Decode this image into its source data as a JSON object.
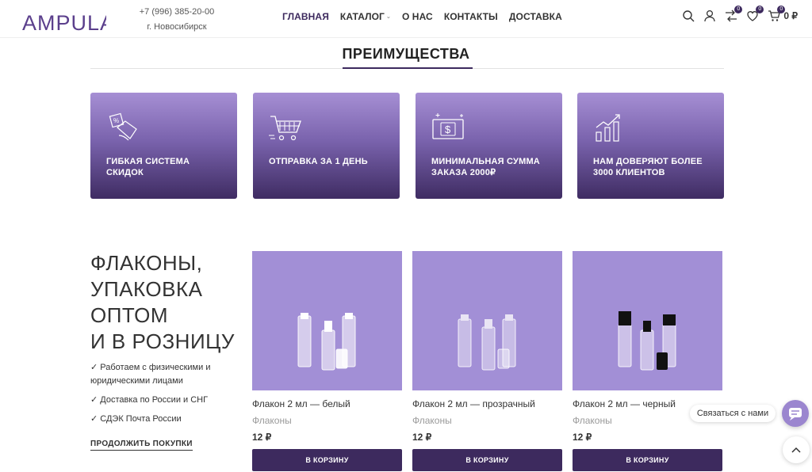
{
  "header": {
    "logo_text": "AMPULA",
    "phone": "+7 (996) 385-20-00",
    "city": "г. Новосибирск",
    "nav": [
      {
        "label": "ГЛАВНАЯ",
        "active": true
      },
      {
        "label": "КАТАЛОГ",
        "dropdown": true
      },
      {
        "label": "О НАС"
      },
      {
        "label": "КОНТАКТЫ"
      },
      {
        "label": "ДОСТАВКА"
      }
    ],
    "compare_count": "0",
    "wishlist_count": "0",
    "cart_count": "0",
    "cart_total": "0 ₽"
  },
  "advantages": {
    "title": "ПРЕИМУЩЕСТВА",
    "items": [
      {
        "text": "ГИБКАЯ СИСТЕМА СКИДОК",
        "icon": "discount-tag-icon"
      },
      {
        "text": "ОТПРАВКА ЗА 1 ДЕНЬ",
        "icon": "shopping-cart-icon"
      },
      {
        "text": "МИНИМАЛЬНАЯ СУММА ЗАКАЗА 2000₽",
        "icon": "money-bill-icon"
      },
      {
        "text": "НАМ ДОВЕРЯЮТ БОЛЕЕ 3000 КЛИЕНТОВ",
        "icon": "growth-chart-icon"
      }
    ]
  },
  "hero": {
    "title_lines": [
      "ФЛАКОНЫ,",
      "УПАКОВКА",
      "ОПТОМ",
      "И В РОЗНИЦУ"
    ],
    "bullets": [
      "✓ Работаем с физическими и юридическими лицами",
      "✓ Доставка по России и СНГ",
      "✓ СДЭК Почта России"
    ],
    "continue_label": "ПРОДОЛЖИТЬ ПОКУПКИ"
  },
  "products": [
    {
      "name": "Флакон 2 мл — белый",
      "category": "Флаконы",
      "price": "12 ₽",
      "button": "В КОРЗИНУ",
      "cap_color": "#ffffff"
    },
    {
      "name": "Флакон 2 мл — прозрачный",
      "category": "Флаконы",
      "price": "12 ₽",
      "button": "В КОРЗИНУ",
      "cap_color": "#e9e4f4"
    },
    {
      "name": "Флакон 2 мл — черный",
      "category": "Флаконы",
      "price": "12 ₽",
      "button": "В КОРЗИНУ",
      "cap_color": "#111111"
    }
  ],
  "contact": {
    "label": "Связаться с нами"
  },
  "colors": {
    "brand": "#3d2a5e",
    "product_bg": "#a28fd6",
    "card_top": "#a68fd4",
    "card_bottom": "#3f2c63"
  }
}
